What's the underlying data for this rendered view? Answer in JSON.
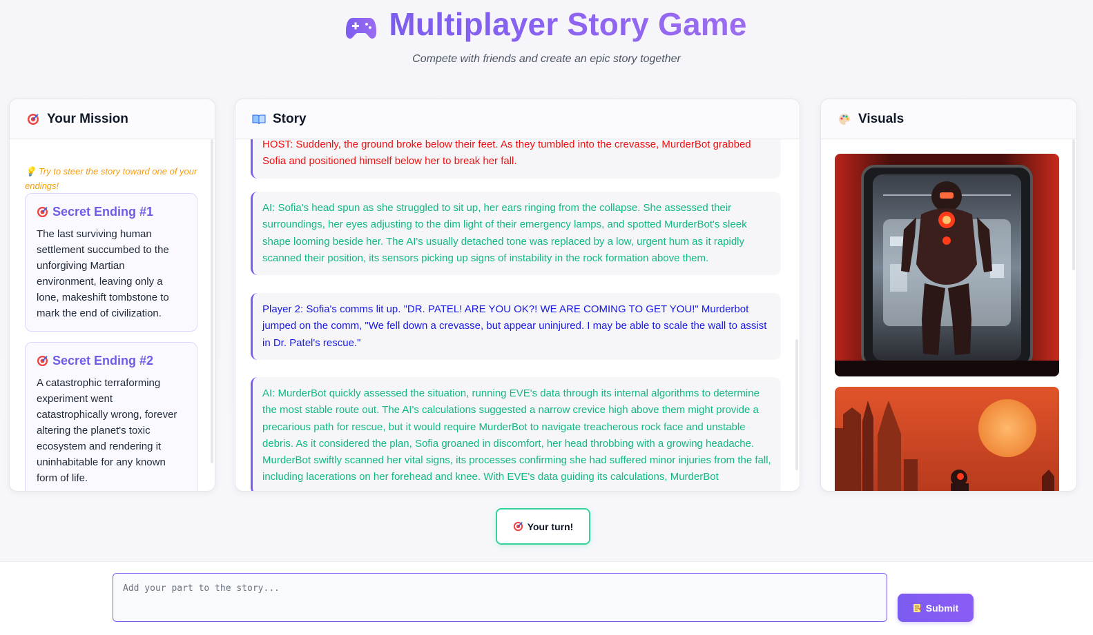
{
  "header": {
    "title": "Multiplayer Story Game",
    "subtitle": "Compete with friends and create an epic story together",
    "icon": "gamepad-icon"
  },
  "mission": {
    "title": "Your Mission",
    "icon": "target-icon",
    "hint": "Try to steer the story toward one of your endings!",
    "hint_icon": "lightbulb-icon",
    "endings": [
      {
        "title": "Secret Ending #1",
        "text": "The last surviving human settlement succumbed to the unforgiving Martian environment, leaving only a lone, makeshift tombstone to mark the end of civilization."
      },
      {
        "title": "Secret Ending #2",
        "text": "A catastrophic terraforming experiment went catastrophically wrong, forever altering the planet's toxic ecosystem and rendering it uninhabitable for any known form of life."
      }
    ]
  },
  "story": {
    "title": "Story",
    "icon": "book-icon",
    "messages": [
      {
        "role": "host",
        "text": "HOST: Suddenly, the ground broke below their feet. As they tumbled into the crevasse, MurderBot grabbed Sofia and positioned himself below her to break her fall."
      },
      {
        "role": "ai",
        "text": "AI: Sofia's head spun as she struggled to sit up, her ears ringing from the collapse. She assessed their surroundings, her eyes adjusting to the dim light of their emergency lamps, and spotted MurderBot's sleek shape looming beside her. The AI's usually detached tone was replaced by a low, urgent hum as it rapidly scanned their position, its sensors picking up signs of instability in the rock formation above them."
      },
      {
        "role": "player",
        "text": "Player 2: Sofia's comms lit up. \"DR. PATEL! ARE YOU OK?! WE ARE COMING TO GET YOU!\" Murderbot jumped on the comm, \"We fell down a crevasse, but appear uninjured. I may be able to scale the wall to assist in Dr. Patel's rescue.\""
      },
      {
        "role": "ai",
        "text": "AI: MurderBot quickly assessed the situation, running EVE's data through its internal algorithms to determine the most stable route out. The AI's calculations suggested a narrow crevice high above them might provide a precarious path for rescue, but it would require MurderBot to navigate treacherous rock face and unstable debris. As it considered the plan, Sofia groaned in discomfort, her head throbbing with a growing headache. MurderBot swiftly scanned her vital signs, its processes confirming she had suffered minor injuries from the fall, including lacerations on her forehead and knee. With EVE's data guiding its calculations, MurderBot"
      }
    ]
  },
  "visuals": {
    "title": "Visuals",
    "icon": "palette-icon",
    "images": [
      {
        "name": "robot-doorway-image"
      },
      {
        "name": "mars-city-sunset-image"
      }
    ]
  },
  "turn": {
    "label": "Your turn!",
    "icon": "target-icon"
  },
  "input": {
    "placeholder": "Add your part to the story...",
    "value": ""
  },
  "submit": {
    "label": "Submit",
    "icon": "memo-icon"
  }
}
